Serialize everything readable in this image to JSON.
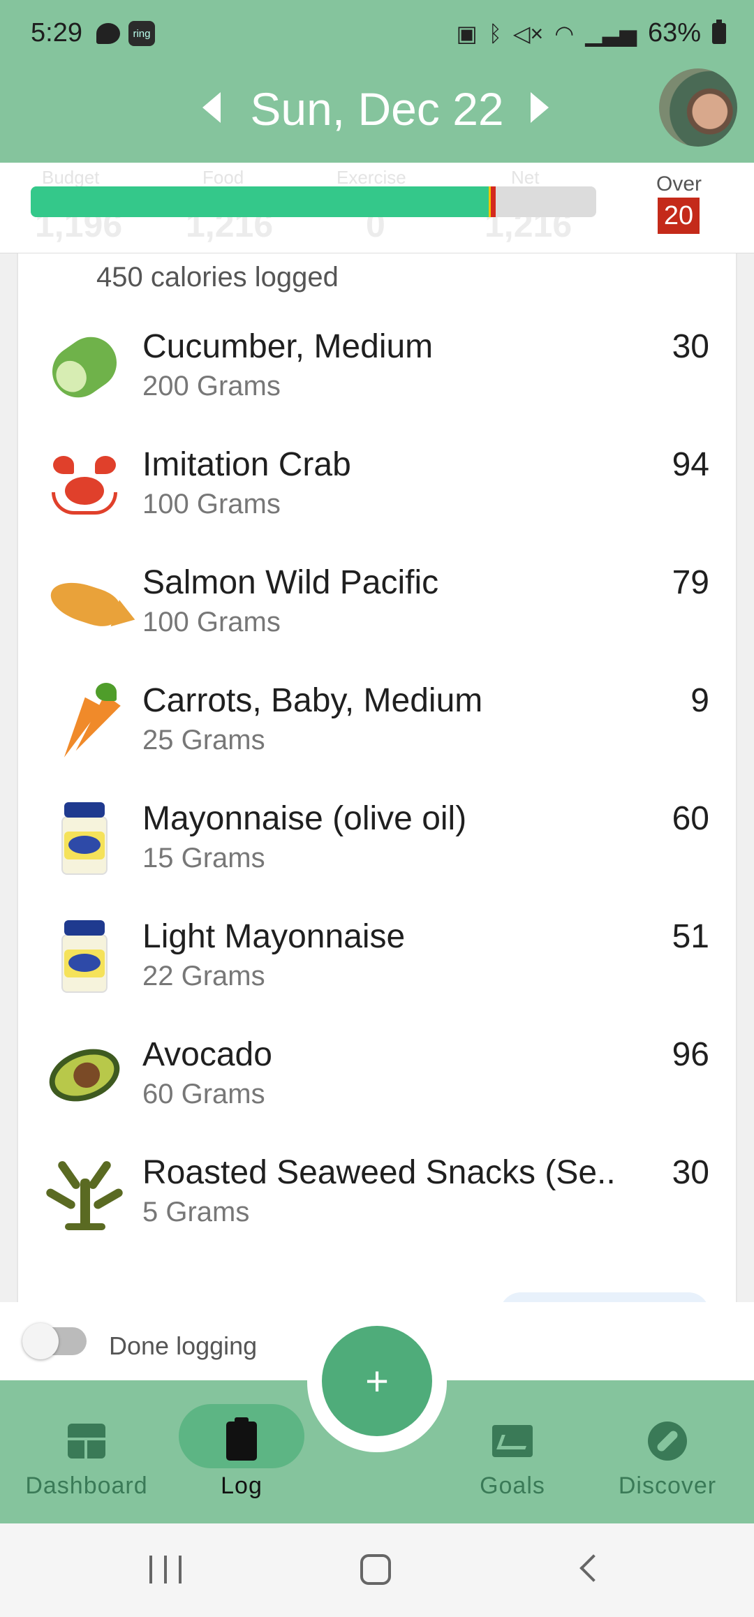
{
  "status_bar": {
    "time": "5:29",
    "ring_badge": "ring",
    "battery": "63%",
    "icons": [
      "chat-icon",
      "ring-icon",
      "nfc-icon",
      "bluetooth-icon",
      "mute-icon",
      "wifi-icon",
      "signal-icon",
      "battery-icon"
    ]
  },
  "header": {
    "date": "Sun, Dec 22",
    "prev_icon": "chevron-left-icon",
    "next_icon": "chevron-right-icon"
  },
  "summary": {
    "faint_labels": [
      "Budget",
      "Food",
      "Exercise",
      "Net"
    ],
    "faint_values": [
      "1,196",
      "1,216",
      "0",
      "1,216"
    ],
    "progress_fraction": 0.81,
    "over_label": "Over",
    "over_value": "20",
    "colors": {
      "progress": "#34c88a",
      "over": "#c42a1a"
    }
  },
  "meal": {
    "logged_text": "450 calories logged",
    "items": [
      {
        "name": "Cucumber, Medium",
        "amount": "200 Grams",
        "calories": "30",
        "icon": "cucumber-icon"
      },
      {
        "name": "Imitation Crab",
        "amount": "100 Grams",
        "calories": "94",
        "icon": "crab-icon"
      },
      {
        "name": "Salmon Wild Pacific",
        "amount": "100 Grams",
        "calories": "79",
        "icon": "fish-icon"
      },
      {
        "name": "Carrots, Baby, Medium",
        "amount": "25 Grams",
        "calories": "9",
        "icon": "carrot-icon"
      },
      {
        "name": "Mayonnaise (olive oil)",
        "amount": "15 Grams",
        "calories": "60",
        "icon": "mayonnaise-icon"
      },
      {
        "name": "Light Mayonnaise",
        "amount": "22 Grams",
        "calories": "51",
        "icon": "mayonnaise-icon"
      },
      {
        "name": "Avocado",
        "amount": "60 Grams",
        "calories": "96",
        "icon": "avocado-icon"
      },
      {
        "name": "Roasted Seaweed Snacks (Se..",
        "amount": "5 Grams",
        "calories": "30",
        "icon": "seaweed-icon"
      }
    ]
  },
  "done_logging": {
    "label": "Done logging",
    "enabled": false
  },
  "fab": {
    "label": "+"
  },
  "nav": {
    "items": [
      {
        "label": "Dashboard",
        "icon": "dashboard-icon",
        "active": false
      },
      {
        "label": "Log",
        "icon": "clipboard-icon",
        "active": true
      },
      {
        "label": "Goals",
        "icon": "goals-icon",
        "active": false
      },
      {
        "label": "Discover",
        "icon": "compass-icon",
        "active": false
      }
    ]
  }
}
